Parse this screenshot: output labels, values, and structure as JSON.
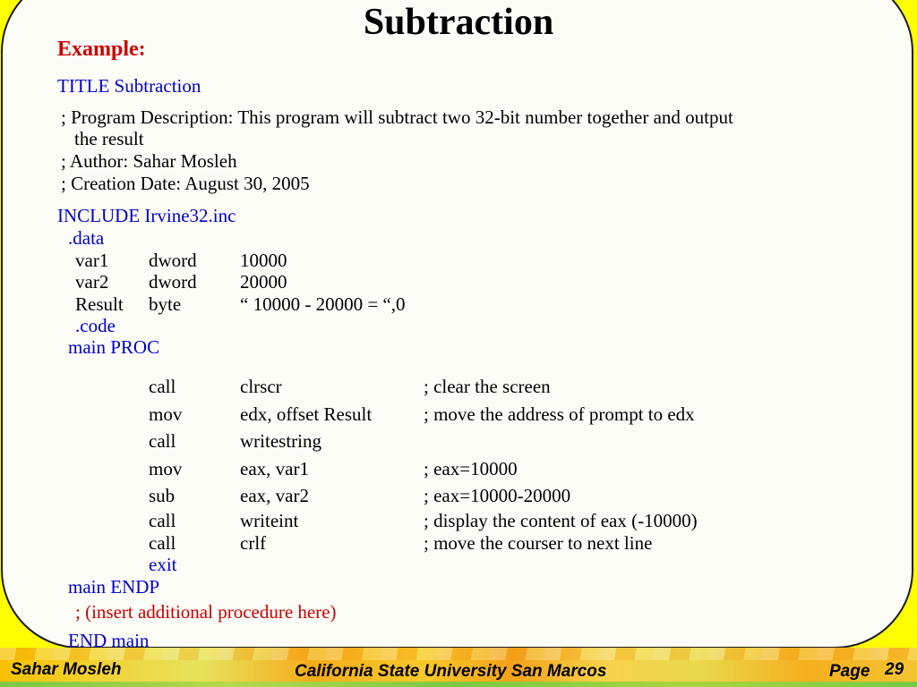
{
  "title": "Subtraction",
  "example_label": "Example:",
  "title_line": "TITLE Subtraction",
  "comments": {
    "desc_line1": "; Program Description: This program will subtract two 32-bit number together and output",
    "desc_line2": "the result",
    "author": "; Author: Sahar Mosleh",
    "date": "; Creation Date: August 30, 2005"
  },
  "include_line": "INCLUDE Irvine32.inc",
  "data_directive": ".data",
  "data_rows": [
    {
      "name": "var1",
      "type": "dword",
      "value": "10000"
    },
    {
      "name": "var2",
      "type": "dword",
      "value": "20000"
    },
    {
      "name": "Result",
      "type": "byte",
      "value": "“ 10000 - 20000 = “,0"
    }
  ],
  "code_directive": ".code",
  "proc_start": "main PROC",
  "code_rows": [
    {
      "op": "call",
      "arg": "clrscr",
      "comment": "; clear the screen"
    },
    {
      "op": "mov",
      "arg": "edx, offset Result",
      "comment": "; move the address of prompt to edx"
    },
    {
      "op": "call",
      "arg": "writestring",
      "comment": ""
    },
    {
      "op": "mov",
      "arg": "eax, var1",
      "comment": "; eax=10000"
    },
    {
      "op": "sub",
      "arg": "eax, var2",
      "comment": "; eax=10000-20000"
    },
    {
      "op": "call",
      "arg": "writeint",
      "comment": "; display the content of eax (-10000)"
    },
    {
      "op": "call",
      "arg": "crlf",
      "comment": "; move the courser to next line"
    }
  ],
  "exit_line": "exit",
  "proc_end": "main ENDP",
  "insert_note": "; (insert additional procedure here)",
  "end_line": "END main",
  "footer": {
    "left": "Sahar Mosleh",
    "center": "California State University San Marcos",
    "page_label": "Page",
    "page_number": "29"
  },
  "colors": {
    "background": "#ffff00",
    "blue_text": "#0000cc",
    "red_text": "#cc0000"
  }
}
